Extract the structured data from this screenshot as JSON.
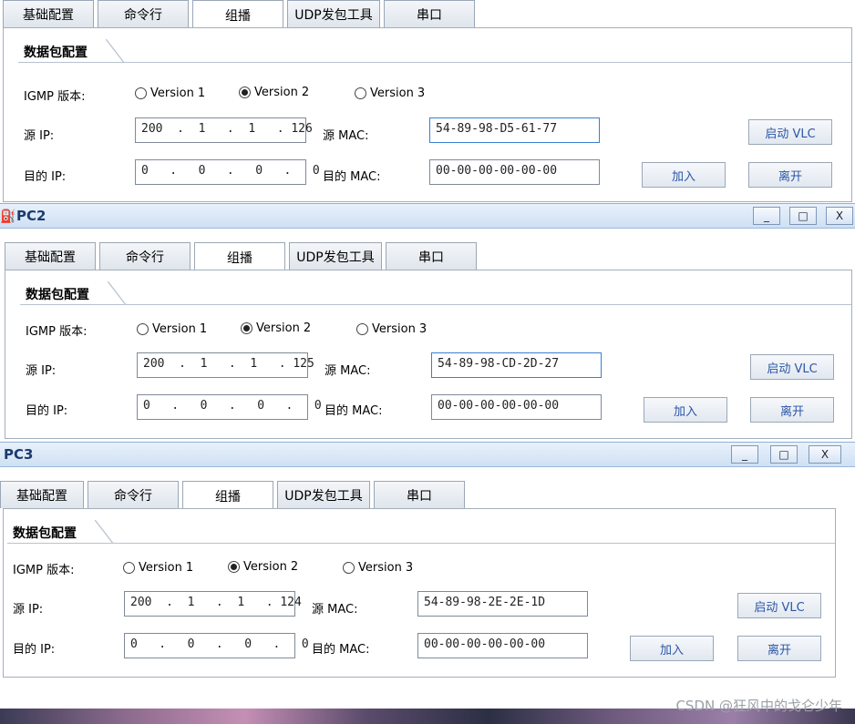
{
  "tabs": [
    "基础配置",
    "命令行",
    "组播",
    "UDP发包工具",
    "串口"
  ],
  "group_title": "数据包配置",
  "igmp_label": "IGMP 版本:",
  "versions": [
    "Version 1",
    "Version 2",
    "Version 3"
  ],
  "selected_version": "Version 2",
  "src_ip_label": "源 IP:",
  "dst_ip_label": "目的 IP:",
  "src_mac_label": "源  MAC:",
  "dst_mac_label": "目的 MAC:",
  "start_vlc_label": "启动 VLC",
  "join_label": "加入",
  "leave_label": "离开",
  "windows": [
    {
      "title": "",
      "src_ip": "200  .  1   .  1   . 126",
      "dst_ip": "0   .   0   .   0   .   0",
      "src_mac": "54-89-98-D5-61-77",
      "dst_mac": "00-00-00-00-00-00"
    },
    {
      "title": "PC2",
      "src_ip": "200  .  1   .  1   . 125",
      "dst_ip": "0   .   0   .   0   .   0",
      "src_mac": "54-89-98-CD-2D-27",
      "dst_mac": "00-00-00-00-00-00"
    },
    {
      "title": "PC3",
      "src_ip": "200  .  1   .  1   . 124",
      "dst_ip": "0   .   0   .   0   .   0",
      "src_mac": "54-89-98-2E-2E-1D",
      "dst_mac": "00-00-00-00-00-00"
    }
  ],
  "window_buttons": {
    "minimize": "_",
    "maximize": "□",
    "close": "X"
  },
  "watermark": "CSDN @狂风中的戈仑少年"
}
